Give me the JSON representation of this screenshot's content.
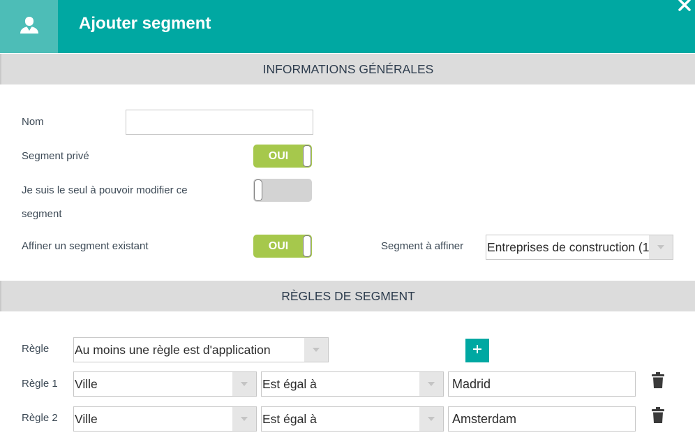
{
  "dialog": {
    "title": "Ajouter segment",
    "header_icon": "user-icon",
    "close_icon": "close-icon",
    "colors": {
      "header": "#00a8a2",
      "header_icon_bg": "#4dbdb7",
      "toggle_on": "#a6c84c",
      "toggle_off": "#d3d3d3"
    }
  },
  "general": {
    "section_title": "INFORMATIONS GÉNÉRALES",
    "name_label": "Nom",
    "name_value": "",
    "private_label": "Segment privé",
    "private_toggle": "OUI",
    "only_me_label": "Je suis le seul à pouvoir modifier ce segment",
    "only_me_toggle": "",
    "refine_label": "Affiner un segment existant",
    "refine_toggle": "OUI",
    "refine_select_label": "Segment à affiner",
    "refine_select_value": "Entreprises de construction (1"
  },
  "rules": {
    "section_title": "RÈGLES DE SEGMENT",
    "rule_label": "Règle",
    "rule_mode_value": "Au moins une règle est d'application",
    "add_icon": "plus-icon",
    "items": [
      {
        "label": "Règle 1",
        "field": "Ville",
        "operator": "Est égal à",
        "value": "Madrid"
      },
      {
        "label": "Règle 2",
        "field": "Ville",
        "operator": "Est égal à",
        "value": "Amsterdam"
      }
    ],
    "delete_icon": "trash-icon"
  }
}
